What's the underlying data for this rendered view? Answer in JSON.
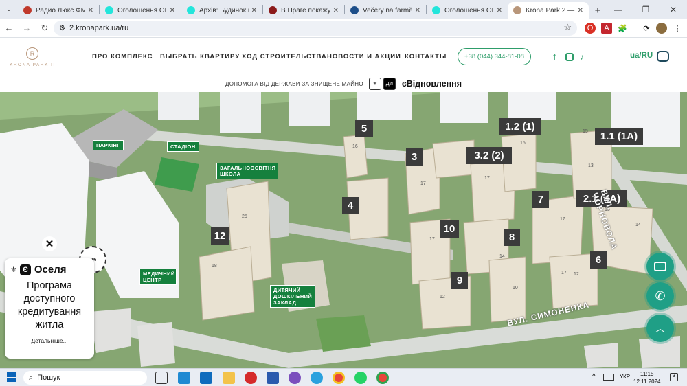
{
  "browser": {
    "tabs": [
      {
        "title": "Радио Люкс ФМ - сл",
        "icon": "radio-icon",
        "color": "#c0392b"
      },
      {
        "title": "Оголошення OLX.ua",
        "icon": "olx-icon",
        "color": "#23e5db"
      },
      {
        "title": "Архів: Будинок в Са",
        "icon": "olx-icon",
        "color": "#23e5db"
      },
      {
        "title": "В Праге покажут ук",
        "icon": "news-icon",
        "color": "#8b1a1a"
      },
      {
        "title": "Večery na farmě u Dj",
        "icon": "text-icon",
        "color": "#1d4e89"
      },
      {
        "title": "Оголошення OLX.ua",
        "icon": "olx-icon",
        "color": "#23e5db"
      },
      {
        "title": "Krona Park 2 — квар",
        "icon": "krona-icon",
        "color": "#b8967a",
        "active": true
      }
    ],
    "new_tab": "+",
    "url": "2.kronapark.ua/ru"
  },
  "site": {
    "logo_text": "KRONA PARK II",
    "logo_mark": "R",
    "nav": [
      "ПРО КОМПЛЕКС",
      "ВЫБРАТЬ КВАРТИРУ",
      "ХОД СТРОИТЕЛЬСТВА",
      "НОВОСТИ И АКЦИИ",
      "КОНТАКТЫ"
    ],
    "phone": "+38 (044) 344-81-08",
    "social": [
      "facebook-icon",
      "instagram-icon",
      "tiktok-icon"
    ],
    "lang": "ua/RU",
    "gov_text": "ДОПОМОГА ВІД ДЕРЖАВИ ЗА ЗНИЩЕНЕ МАЙНО",
    "gov_badge": "Дія",
    "gov_brand": "єВідновлення"
  },
  "map": {
    "building_numbers": [
      "5",
      "1.2 (1)",
      "1.1 (1A)",
      "3",
      "3.2 (2)",
      "4",
      "7",
      "2.1 (4A)",
      "12",
      "10",
      "8",
      "6",
      "9"
    ],
    "facility_labels": [
      "ПАРКІНГ",
      "СТАДІОН",
      "ЗАГАЛЬНООСВІТНЯ ШКОЛА",
      "МЕДИЧНИЙ ЦЕНТР",
      "ДИТЯЧИЙ ДОШКІЛЬНИЙ ЗАКЛАД"
    ],
    "streets": [
      "ВУЛ. ЧОРНОВОЛА",
      "ВУЛ. СИМОНЕНКА"
    ],
    "floor_counts": [
      "16",
      "15",
      "25",
      "18",
      "17",
      "17",
      "17",
      "17",
      "15",
      "13",
      "17",
      "14",
      "14",
      "12",
      "10",
      "12",
      "16",
      "13"
    ]
  },
  "promo": {
    "brand_e": "Є",
    "brand": "Оселя",
    "text": "Програма доступного кредитування житла",
    "link": "Детальніше...",
    "badge": "7%",
    "close": "✕"
  },
  "taskbar": {
    "search": "Пошук",
    "lang": "УКР",
    "time": "11:15",
    "date": "12.11.2024"
  }
}
